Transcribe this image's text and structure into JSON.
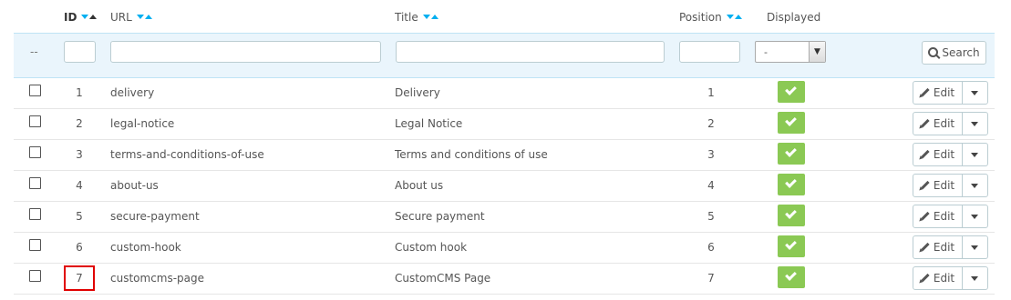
{
  "table": {
    "headers": {
      "id": "ID",
      "url": "URL",
      "title": "Title",
      "position": "Position",
      "displayed": "Displayed"
    },
    "filter": {
      "bulk_placeholder": "--",
      "id_value": "",
      "url_value": "",
      "title_value": "",
      "position_value": "",
      "displayed_selected": "-",
      "search_label": "Search"
    },
    "rows": [
      {
        "id": "1",
        "url": "delivery",
        "title": "Delivery",
        "position": "1",
        "displayed": true
      },
      {
        "id": "2",
        "url": "legal-notice",
        "title": "Legal Notice",
        "position": "2",
        "displayed": true
      },
      {
        "id": "3",
        "url": "terms-and-conditions-of-use",
        "title": "Terms and conditions of use",
        "position": "3",
        "displayed": true
      },
      {
        "id": "4",
        "url": "about-us",
        "title": "About us",
        "position": "4",
        "displayed": true
      },
      {
        "id": "5",
        "url": "secure-payment",
        "title": "Secure payment",
        "position": "5",
        "displayed": true
      },
      {
        "id": "6",
        "url": "custom-hook",
        "title": "Custom hook",
        "position": "6",
        "displayed": true
      },
      {
        "id": "7",
        "url": "customcms-page",
        "title": "CustomCMS Page",
        "position": "7",
        "displayed": true,
        "highlighted": true
      }
    ],
    "row_actions": {
      "edit_label": "Edit"
    }
  },
  "colors": {
    "sort_caret": "#00aff0",
    "filter_bg": "#eaf5fc",
    "enabled_badge": "#8bc954",
    "highlight": "#e00000"
  },
  "icons": {
    "search": "search-icon",
    "edit": "pencil-icon",
    "enabled": "check-icon",
    "dropdown": "caret-down-icon"
  }
}
